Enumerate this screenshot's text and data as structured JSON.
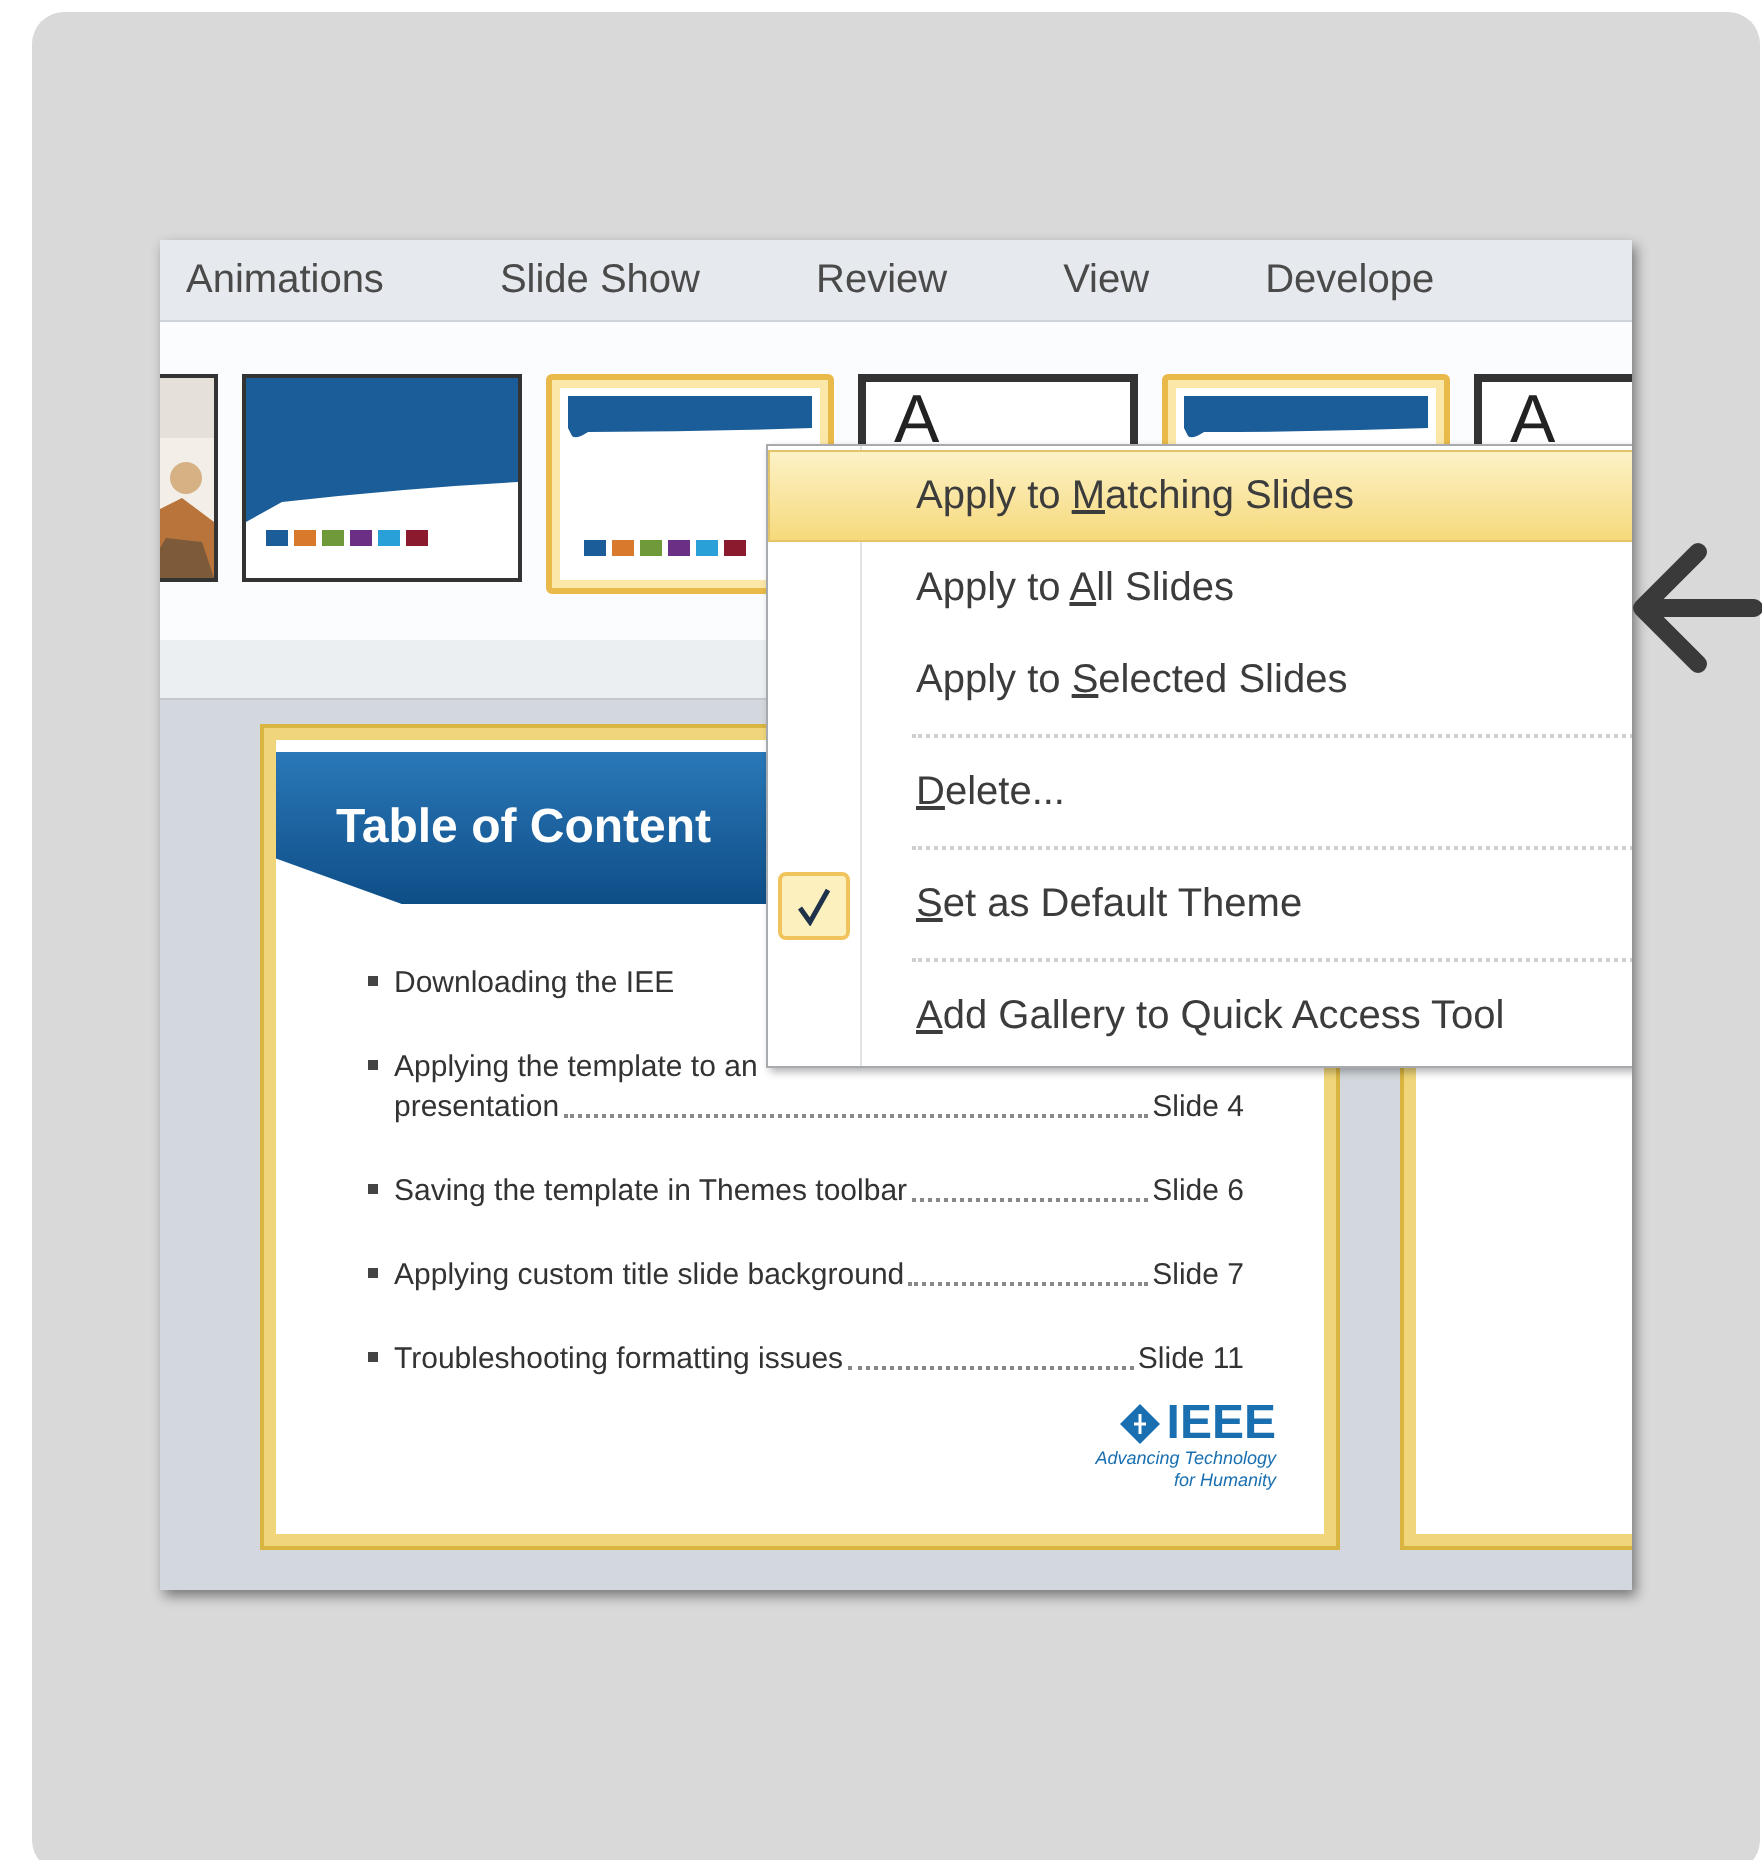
{
  "tabs": [
    {
      "label": "Animations"
    },
    {
      "label": "Slide Show"
    },
    {
      "label": "Review"
    },
    {
      "label": "View"
    },
    {
      "label": "Develope"
    }
  ],
  "gallery": [
    {
      "kind": "picture",
      "selected": false
    },
    {
      "kind": "blue",
      "selected": false
    },
    {
      "kind": "banner",
      "selected": true
    },
    {
      "kind": "letter",
      "glyph": "A",
      "selected": false
    },
    {
      "kind": "banner",
      "selected": true
    },
    {
      "kind": "letter",
      "glyph": "A",
      "selected": false
    }
  ],
  "slide": {
    "title": "Table of Content",
    "items": [
      {
        "lines": [
          "Downloading the IEE"
        ]
      },
      {
        "lines": [
          "Applying the template to an",
          "presentation"
        ],
        "page": "Slide 4"
      },
      {
        "lines": [
          "Saving the template in Themes toolbar"
        ],
        "page": "Slide 6"
      },
      {
        "lines": [
          "Applying custom title slide background"
        ],
        "page": "Slide 7"
      },
      {
        "lines": [
          "Troubleshooting formatting issues"
        ],
        "page": "Slide 11"
      }
    ],
    "logo": {
      "name": "IEEE",
      "tagline": [
        "Advancing Technology",
        "for Humanity"
      ]
    }
  },
  "menu": [
    {
      "kind": "item",
      "before": "Apply to ",
      "key": "M",
      "after": "atching Slides",
      "highlighted": true,
      "checked": false
    },
    {
      "kind": "item",
      "before": "Apply to ",
      "key": "A",
      "after": "ll Slides",
      "highlighted": false,
      "checked": false
    },
    {
      "kind": "item",
      "before": "Apply to ",
      "key": "S",
      "after": "elected Slides",
      "highlighted": false,
      "checked": false
    },
    {
      "kind": "separator"
    },
    {
      "kind": "item",
      "key": "D",
      "after": "elete...",
      "highlighted": false,
      "checked": false
    },
    {
      "kind": "separator"
    },
    {
      "kind": "item",
      "key": "S",
      "after": "et as Default Theme",
      "highlighted": false,
      "checked": true
    },
    {
      "kind": "separator"
    },
    {
      "kind": "item",
      "key": "A",
      "after": "dd Gallery to Quick Access Tool",
      "highlighted": false,
      "checked": false
    }
  ]
}
